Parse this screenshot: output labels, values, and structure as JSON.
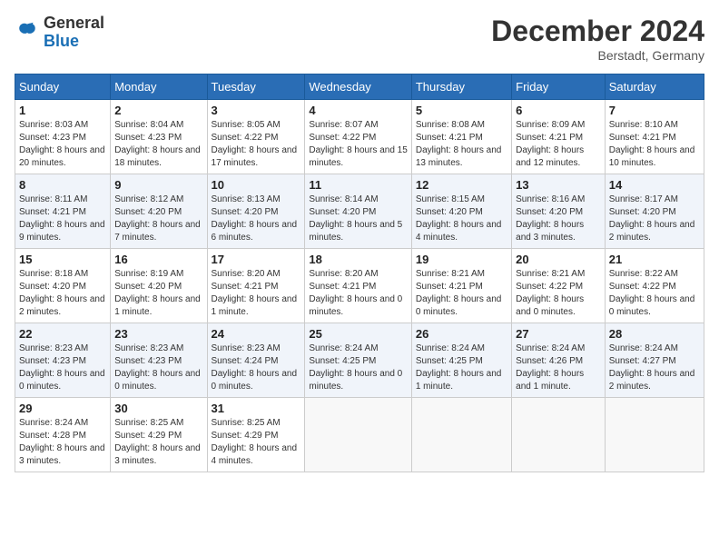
{
  "header": {
    "logo_general": "General",
    "logo_blue": "Blue",
    "month_year": "December 2024",
    "location": "Berstadt, Germany"
  },
  "days_of_week": [
    "Sunday",
    "Monday",
    "Tuesday",
    "Wednesday",
    "Thursday",
    "Friday",
    "Saturday"
  ],
  "weeks": [
    [
      {
        "day": "1",
        "sunrise": "8:03 AM",
        "sunset": "4:23 PM",
        "daylight": "8 hours and 20 minutes."
      },
      {
        "day": "2",
        "sunrise": "8:04 AM",
        "sunset": "4:23 PM",
        "daylight": "8 hours and 18 minutes."
      },
      {
        "day": "3",
        "sunrise": "8:05 AM",
        "sunset": "4:22 PM",
        "daylight": "8 hours and 17 minutes."
      },
      {
        "day": "4",
        "sunrise": "8:07 AM",
        "sunset": "4:22 PM",
        "daylight": "8 hours and 15 minutes."
      },
      {
        "day": "5",
        "sunrise": "8:08 AM",
        "sunset": "4:21 PM",
        "daylight": "8 hours and 13 minutes."
      },
      {
        "day": "6",
        "sunrise": "8:09 AM",
        "sunset": "4:21 PM",
        "daylight": "8 hours and 12 minutes."
      },
      {
        "day": "7",
        "sunrise": "8:10 AM",
        "sunset": "4:21 PM",
        "daylight": "8 hours and 10 minutes."
      }
    ],
    [
      {
        "day": "8",
        "sunrise": "8:11 AM",
        "sunset": "4:21 PM",
        "daylight": "8 hours and 9 minutes."
      },
      {
        "day": "9",
        "sunrise": "8:12 AM",
        "sunset": "4:20 PM",
        "daylight": "8 hours and 7 minutes."
      },
      {
        "day": "10",
        "sunrise": "8:13 AM",
        "sunset": "4:20 PM",
        "daylight": "8 hours and 6 minutes."
      },
      {
        "day": "11",
        "sunrise": "8:14 AM",
        "sunset": "4:20 PM",
        "daylight": "8 hours and 5 minutes."
      },
      {
        "day": "12",
        "sunrise": "8:15 AM",
        "sunset": "4:20 PM",
        "daylight": "8 hours and 4 minutes."
      },
      {
        "day": "13",
        "sunrise": "8:16 AM",
        "sunset": "4:20 PM",
        "daylight": "8 hours and 3 minutes."
      },
      {
        "day": "14",
        "sunrise": "8:17 AM",
        "sunset": "4:20 PM",
        "daylight": "8 hours and 2 minutes."
      }
    ],
    [
      {
        "day": "15",
        "sunrise": "8:18 AM",
        "sunset": "4:20 PM",
        "daylight": "8 hours and 2 minutes."
      },
      {
        "day": "16",
        "sunrise": "8:19 AM",
        "sunset": "4:20 PM",
        "daylight": "8 hours and 1 minute."
      },
      {
        "day": "17",
        "sunrise": "8:20 AM",
        "sunset": "4:21 PM",
        "daylight": "8 hours and 1 minute."
      },
      {
        "day": "18",
        "sunrise": "8:20 AM",
        "sunset": "4:21 PM",
        "daylight": "8 hours and 0 minutes."
      },
      {
        "day": "19",
        "sunrise": "8:21 AM",
        "sunset": "4:21 PM",
        "daylight": "8 hours and 0 minutes."
      },
      {
        "day": "20",
        "sunrise": "8:21 AM",
        "sunset": "4:22 PM",
        "daylight": "8 hours and 0 minutes."
      },
      {
        "day": "21",
        "sunrise": "8:22 AM",
        "sunset": "4:22 PM",
        "daylight": "8 hours and 0 minutes."
      }
    ],
    [
      {
        "day": "22",
        "sunrise": "8:23 AM",
        "sunset": "4:23 PM",
        "daylight": "8 hours and 0 minutes."
      },
      {
        "day": "23",
        "sunrise": "8:23 AM",
        "sunset": "4:23 PM",
        "daylight": "8 hours and 0 minutes."
      },
      {
        "day": "24",
        "sunrise": "8:23 AM",
        "sunset": "4:24 PM",
        "daylight": "8 hours and 0 minutes."
      },
      {
        "day": "25",
        "sunrise": "8:24 AM",
        "sunset": "4:25 PM",
        "daylight": "8 hours and 0 minutes."
      },
      {
        "day": "26",
        "sunrise": "8:24 AM",
        "sunset": "4:25 PM",
        "daylight": "8 hours and 1 minute."
      },
      {
        "day": "27",
        "sunrise": "8:24 AM",
        "sunset": "4:26 PM",
        "daylight": "8 hours and 1 minute."
      },
      {
        "day": "28",
        "sunrise": "8:24 AM",
        "sunset": "4:27 PM",
        "daylight": "8 hours and 2 minutes."
      }
    ],
    [
      {
        "day": "29",
        "sunrise": "8:24 AM",
        "sunset": "4:28 PM",
        "daylight": "8 hours and 3 minutes."
      },
      {
        "day": "30",
        "sunrise": "8:25 AM",
        "sunset": "4:29 PM",
        "daylight": "8 hours and 3 minutes."
      },
      {
        "day": "31",
        "sunrise": "8:25 AM",
        "sunset": "4:29 PM",
        "daylight": "8 hours and 4 minutes."
      },
      null,
      null,
      null,
      null
    ]
  ]
}
